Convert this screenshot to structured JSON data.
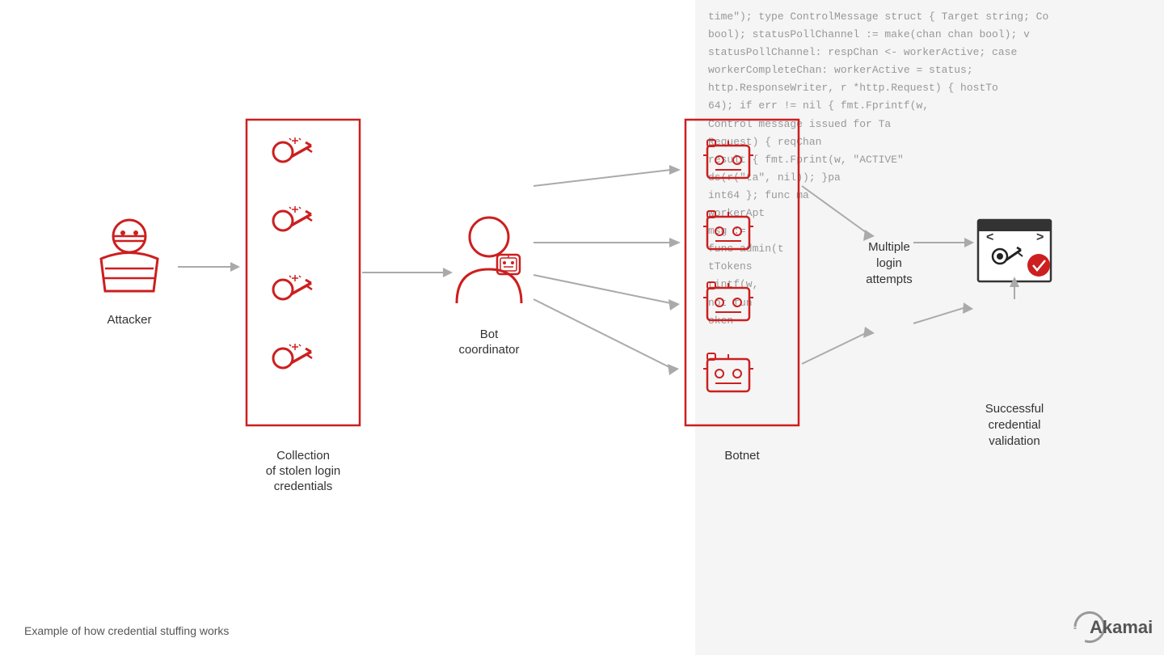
{
  "code": {
    "lines": [
      "time\"); type ControlMessage struct { Target string; Co",
      "   bool); statusPollChannel := make(chan chan bool); v",
      "      statusPollChannel: respChan <- workerActive; case",
      "         workerCompleteChan: workerActive = status;",
      "      http.ResponseWriter, r *http.Request) { hostTo",
      "   64); if err != nil { fmt.Fprintf(w,",
      "      Control message issued for Ta",
      "         Request) { reqChan",
      "   result { fmt.Fprint(w, \"ACTIVE\"",
      "      ds(r(\"ta\", nil)); }pa",
      "         int64 }; func ma",
      "            workerApt",
      "   msg :=",
      "      func admin(t",
      "         tTokens",
      "            rintf(w,",
      "               not fun",
      "                  oken"
    ]
  },
  "labels": {
    "attacker": "Attacker",
    "collection": "Collection\nof stolen login\ncredentials",
    "bot_coordinator": "Bot\ncoordinator",
    "botnet": "Botnet",
    "multiple_login": "Multiple\nlogin\nattempts",
    "successful_credential": "Successful\ncredential\nvalidation",
    "footer": "Example of how credential stuffing works",
    "akamai": "Akamai"
  },
  "colors": {
    "red": "#cc1f1f",
    "gray_arrow": "#aaaaaa",
    "text_dark": "#333333",
    "text_medium": "#555555",
    "bg_code": "#f5f5f5"
  }
}
